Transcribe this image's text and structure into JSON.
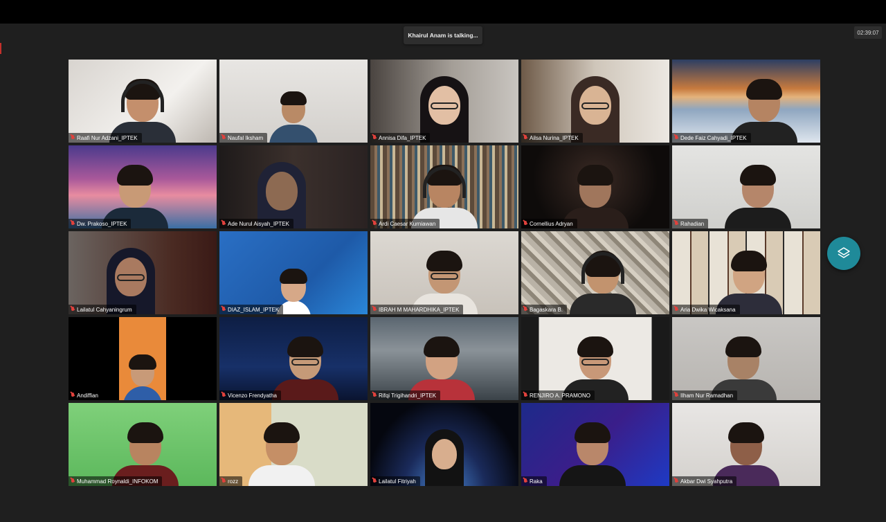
{
  "app": {
    "speaking_indicator": "Khairul Anam is talking...",
    "timer": "02:39:07"
  },
  "colors": {
    "accent": "#1f8a99",
    "mic_muted": "#e0413c",
    "background": "#1f1f1f"
  },
  "actions": {
    "floating_button_icon": "layers-icon"
  },
  "participants": [
    {
      "name": "Raafi Nur Adzani_IPTEK",
      "muted": true
    },
    {
      "name": "Naufal Iksham",
      "muted": true
    },
    {
      "name": "Annisa Difa_IPTEK",
      "muted": true
    },
    {
      "name": "Ailsa Nurina_IPTEK",
      "muted": true
    },
    {
      "name": "Dede Faiz Cahyadi_IPTEK",
      "muted": true
    },
    {
      "name": "Dw. Prakoso_IPTEK",
      "muted": true
    },
    {
      "name": "Ade Nurul Aisyah_IPTEK",
      "muted": true
    },
    {
      "name": "Ardi Caesar Kurniawan",
      "muted": true
    },
    {
      "name": "Cornellius Adryan",
      "muted": true
    },
    {
      "name": "Rahadian",
      "muted": true
    },
    {
      "name": "Lailatul Cahyaningrum",
      "muted": true
    },
    {
      "name": "DIAZ_ISLAM_IPTEK",
      "muted": true
    },
    {
      "name": "IBRAH M MAHARDHIKA_IPTEK",
      "muted": true
    },
    {
      "name": "Bagaskara B.",
      "muted": true
    },
    {
      "name": "Aria Dwika Wicaksana",
      "muted": true
    },
    {
      "name": "Andiffian",
      "muted": true
    },
    {
      "name": "Vicenzo Frendyatha",
      "muted": true
    },
    {
      "name": "Rifqi Trigihandri_IPTEK",
      "muted": true
    },
    {
      "name": "RENJIRO A. PRAMONO",
      "muted": true
    },
    {
      "name": "Ilham Nur Ramadhan",
      "muted": true
    },
    {
      "name": "Muhammad Roynaldi_INFOKOM",
      "muted": true
    },
    {
      "name": "rozz",
      "muted": true
    },
    {
      "name": "Lailatul Fitriyah",
      "muted": true
    },
    {
      "name": "Raka",
      "muted": true
    },
    {
      "name": "Akbar Dwi Syahputra",
      "muted": true
    }
  ]
}
